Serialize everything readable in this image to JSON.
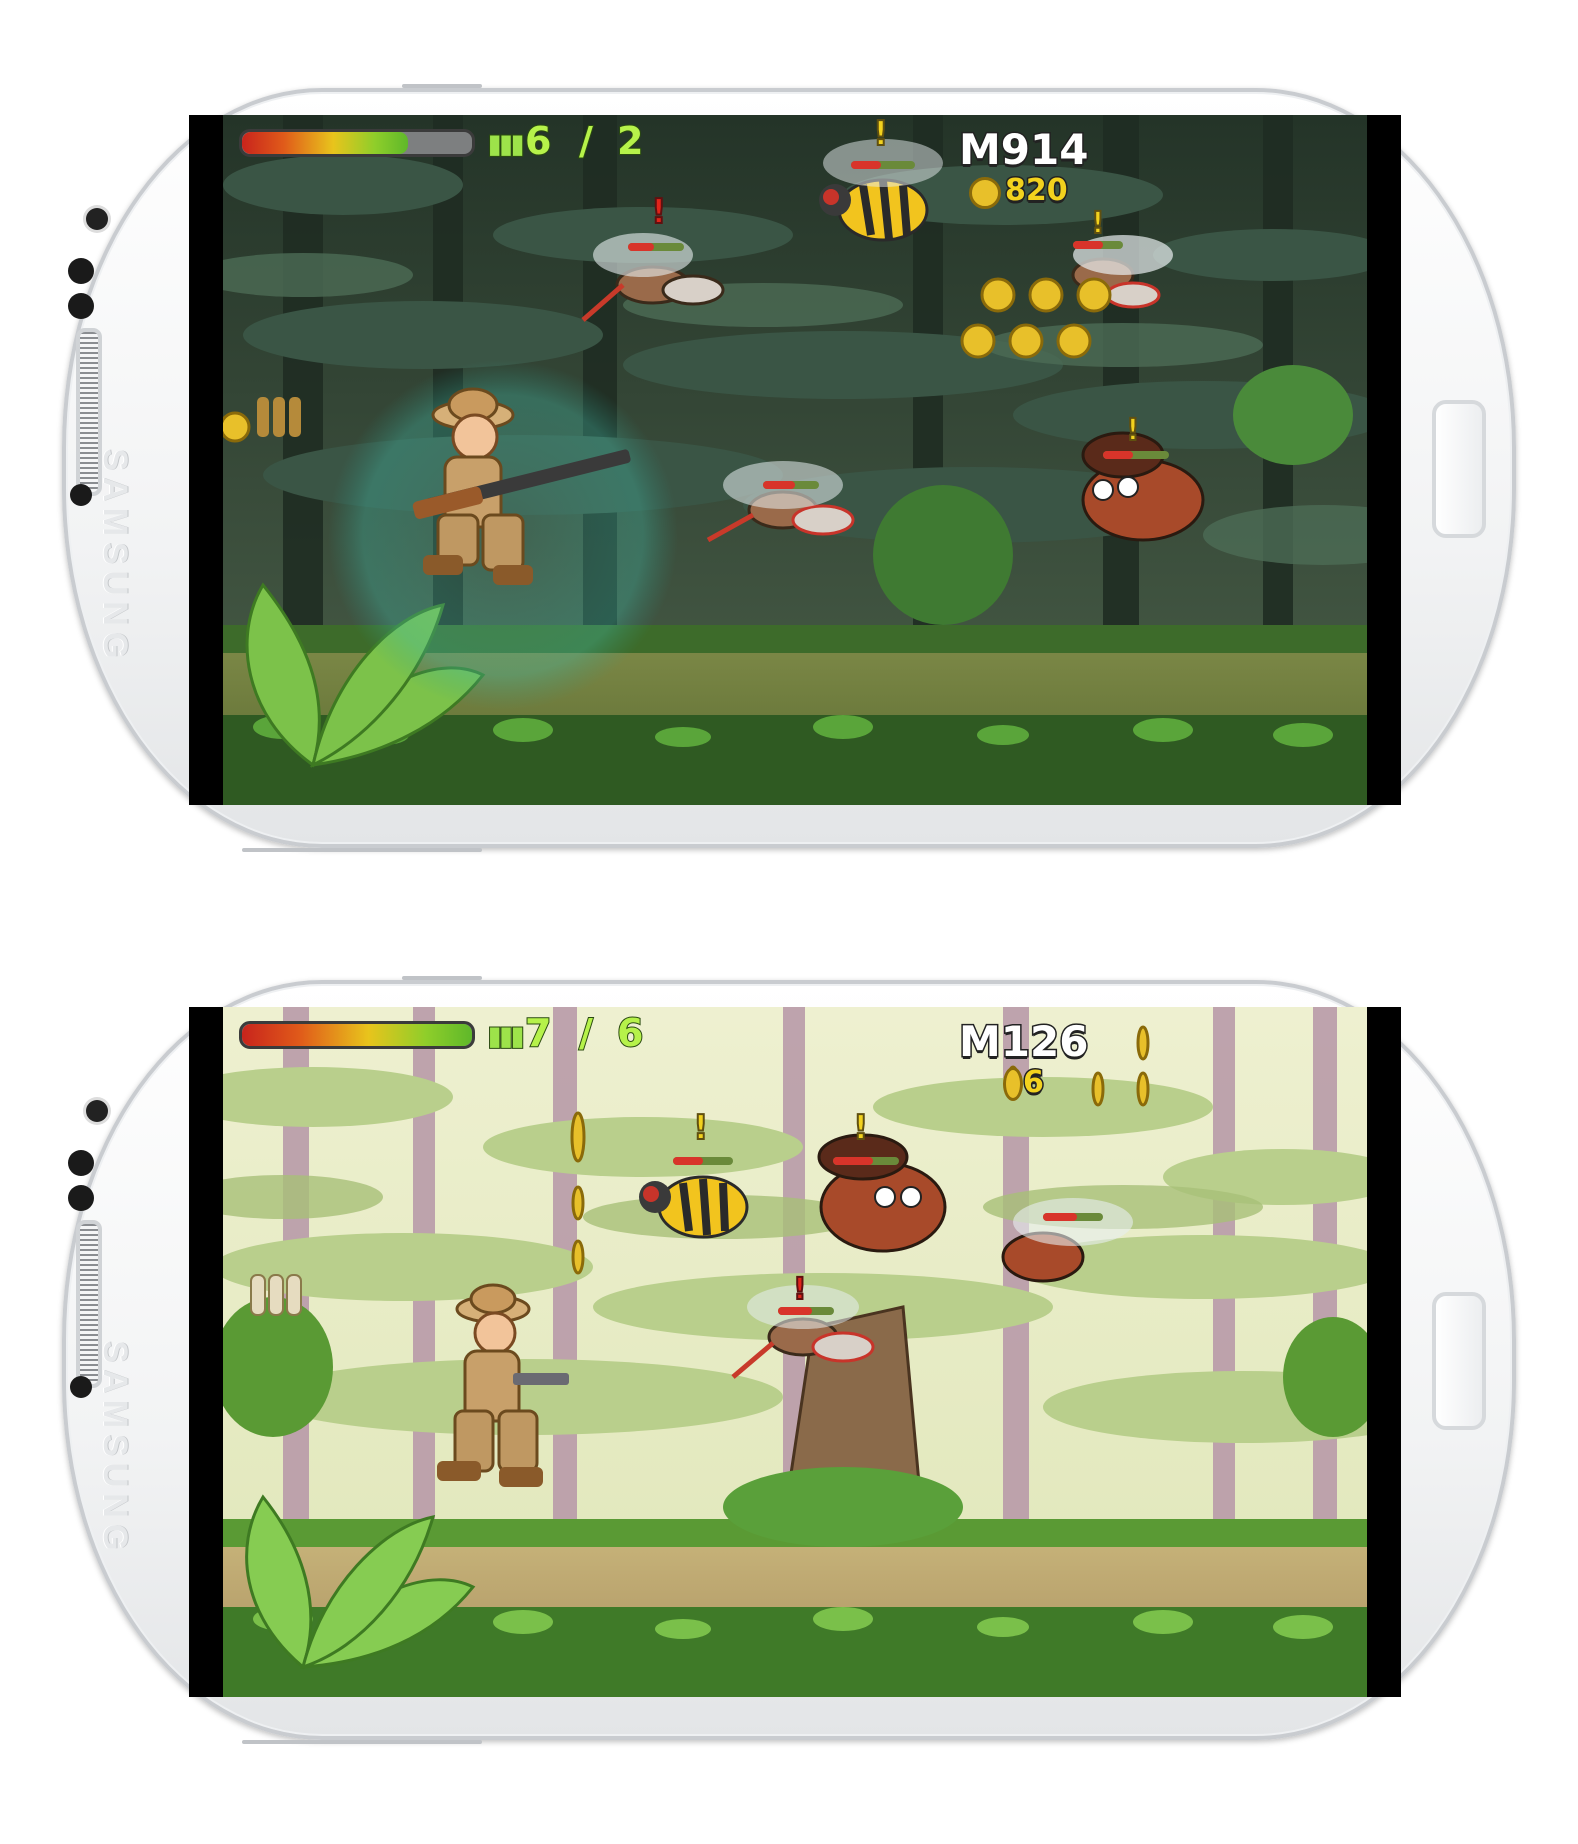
{
  "phones": [
    {
      "brand": "SAMSUNG",
      "hud": {
        "health_fraction": 0.72,
        "ammo_icon": "bullets-icon",
        "ammo_current": "6",
        "ammo_separator": "/",
        "ammo_clips": "2",
        "distance": "M914",
        "coins": "820"
      },
      "weapon": "rifle",
      "theme": "dark-jungle",
      "colors": {
        "sky": "#2a3b30",
        "canopy": "#3d5b48",
        "ground": "#6e7a3a"
      }
    },
    {
      "brand": "SAMSUNG",
      "hud": {
        "health_fraction": 1.0,
        "ammo_icon": "bullets-icon",
        "ammo_current": "7",
        "ammo_separator": "/",
        "ammo_clips": "6",
        "distance": "M126",
        "coins": "6"
      },
      "weapon": "revolver",
      "theme": "bright-jungle",
      "colors": {
        "sky": "#e8ecc8",
        "canopy": "#b7cd8a",
        "ground": "#b9a46a"
      }
    }
  ]
}
